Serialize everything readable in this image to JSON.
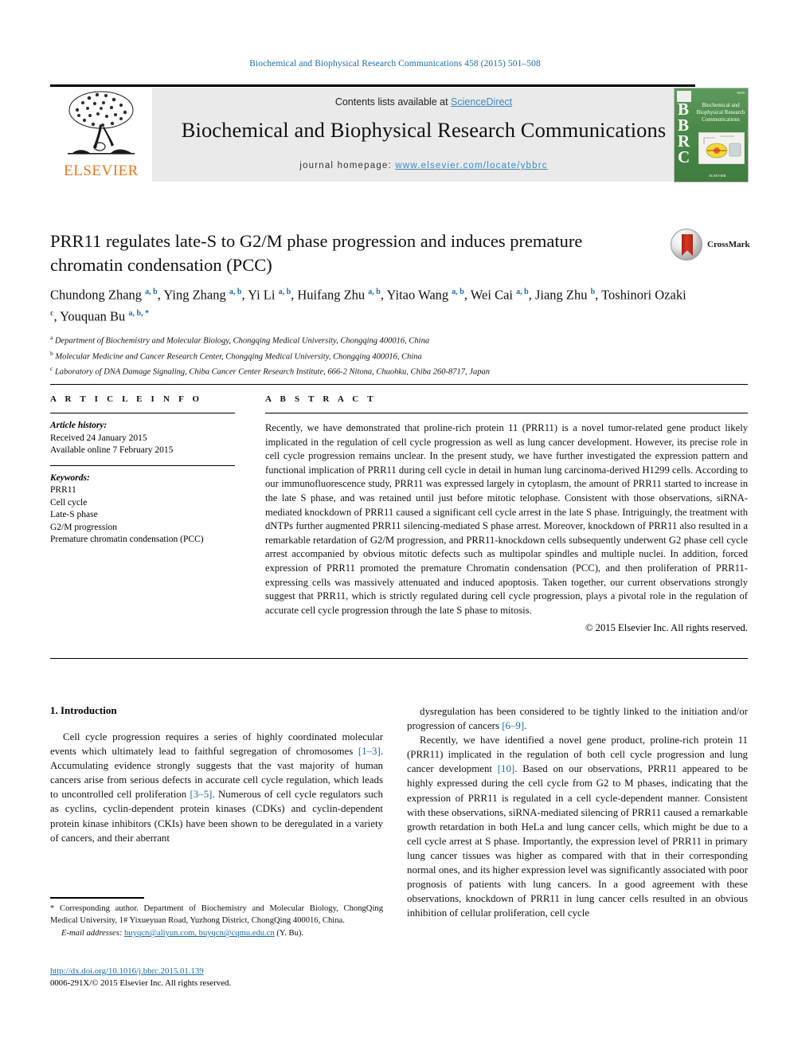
{
  "running_head": "Biochemical and Biophysical Research Communications 458 (2015) 501–508",
  "masthead": {
    "contents_prefix": "Contents lists available at ",
    "sciencedirect": "ScienceDirect",
    "journal_title": "Biochemical and Biophysical Research Communications",
    "homepage_label": "journal homepage: ",
    "homepage_url": "www.elsevier.com/locate/ybbrc",
    "publisher_logo_text": "ELSEVIER",
    "accent_link_color": "#3a8bc6"
  },
  "cover": {
    "bbrc_letters": "B\nB\nR\nC",
    "title_lines": "Biochemical and Biophysical Research Communications",
    "footer_text": "ELSEVIER",
    "top_right": "ISSN",
    "background_color": "#4c8a4c"
  },
  "crossmark": {
    "label": "CrossMark"
  },
  "article": {
    "title": "PRR11 regulates late-S to G2/M phase progression and induces premature chromatin condensation (PCC)",
    "authors_html": "Chundong Zhang <sup>a, b</sup>, Ying Zhang <sup>a, b</sup>, Yi Li <sup>a, b</sup>, Huifang Zhu <sup>a, b</sup>, Yitao Wang <sup>a, b</sup>, Wei Cai <sup>a, b</sup>, Jiang Zhu <sup>b</sup>, Toshinori Ozaki <sup>c</sup>, Youquan Bu <sup>a, b, *</sup>",
    "affiliations": [
      {
        "marker": "a",
        "text": "Department of Biochemistry and Molecular Biology, Chongqing Medical University, Chongqing 400016, China"
      },
      {
        "marker": "b",
        "text": "Molecular Medicine and Cancer Research Center, Chongqing Medical University, Chongqing 400016, China"
      },
      {
        "marker": "c",
        "text": "Laboratory of DNA Damage Signaling, Chiba Cancer Center Research Institute, 666-2 Nitona, Chuohku, Chiba 260-8717, Japan"
      }
    ]
  },
  "article_info": {
    "heading": "A R T I C L E   I N F O",
    "history_label": "Article history:",
    "history_lines": [
      "Received 24 January 2015",
      "Available online 7 February 2015"
    ],
    "keywords_label": "Keywords:",
    "keywords": [
      "PRR11",
      "Cell cycle",
      "Late-S phase",
      "G2/M progression",
      "Premature chromatin condensation (PCC)"
    ]
  },
  "abstract": {
    "heading": "A B S T R A C T",
    "text": "Recently, we have demonstrated that proline-rich protein 11 (PRR11) is a novel tumor-related gene product likely implicated in the regulation of cell cycle progression as well as lung cancer development. However, its precise role in cell cycle progression remains unclear. In the present study, we have further investigated the expression pattern and functional implication of PRR11 during cell cycle in detail in human lung carcinoma-derived H1299 cells. According to our immunofluorescence study, PRR11 was expressed largely in cytoplasm, the amount of PRR11 started to increase in the late S phase, and was retained until just before mitotic telophase. Consistent with those observations, siRNA-mediated knockdown of PRR11 caused a significant cell cycle arrest in the late S phase. Intriguingly, the treatment with dNTPs further augmented PRR11 silencing-mediated S phase arrest. Moreover, knockdown of PRR11 also resulted in a remarkable retardation of G2/M progression, and PRR11-knockdown cells subsequently underwent G2 phase cell cycle arrest accompanied by obvious mitotic defects such as multipolar spindles and multiple nuclei. In addition, forced expression of PRR11 promoted the premature Chromatin condensation (PCC), and then proliferation of PRR11-expressing cells was massively attenuated and induced apoptosis. Taken together, our current observations strongly suggest that PRR11, which is strictly regulated during cell cycle progression, plays a pivotal role in the regulation of accurate cell cycle progression through the late S phase to mitosis.",
    "copyright": "© 2015 Elsevier Inc. All rights reserved."
  },
  "introduction": {
    "heading": "1.  Introduction",
    "left_paragraphs": [
      "Cell cycle progression requires a series of highly coordinated molecular events which ultimately lead to faithful segregation of chromosomes [1–3]. Accumulating evidence strongly suggests that the vast majority of human cancers arise from serious defects in accurate cell cycle regulation, which leads to uncontrolled cell proliferation [3–5]. Numerous of cell cycle regulators such as cyclins, cyclin-dependent protein kinases (CDKs) and cyclin-dependent protein kinase inhibitors (CKIs) have been shown to be deregulated in a variety of cancers, and their aberrant"
    ],
    "right_paragraphs": [
      "dysregulation has been considered to be tightly linked to the initiation and/or progression of cancers [6–9].",
      "Recently, we have identified a novel gene product, proline-rich protein 11 (PRR11) implicated in the regulation of both cell cycle progression and lung cancer development [10]. Based on our observations, PRR11 appeared to be highly expressed during the cell cycle from G2 to M phases, indicating that the expression of PRR11 is regulated in a cell cycle-dependent manner. Consistent with these observations, siRNA-mediated silencing of PRR11 caused a remarkable growth retardation in both HeLa and lung cancer cells, which might be due to a cell cycle arrest at S phase. Importantly, the expression level of PRR11 in primary lung cancer tissues was higher as compared with that in their corresponding normal ones, and its higher expression level was significantly associated with poor prognosis of patients with lung cancers. In a good agreement with these observations, knockdown of PRR11 in lung cancer cells resulted in an obvious inhibition of cellular proliferation, cell cycle"
    ]
  },
  "footnote": {
    "corresponding_text": "* Corresponding author. Department of Biochemistry and Molecular Biology, ChongQing Medical University, 1# Yixueyuan Road, Yuzhong District, ChongQing 400016, China.",
    "email_label": "E-mail addresses:",
    "emails": "buyqcn@aliyun.com, buyqcn@cqmu.edu.cn",
    "email_suffix": "(Y. Bu)."
  },
  "doi": {
    "url": "http://dx.doi.org/10.1016/j.bbrc.2015.01.139",
    "issn_line": "0006-291X/© 2015 Elsevier Inc. All rights reserved."
  }
}
